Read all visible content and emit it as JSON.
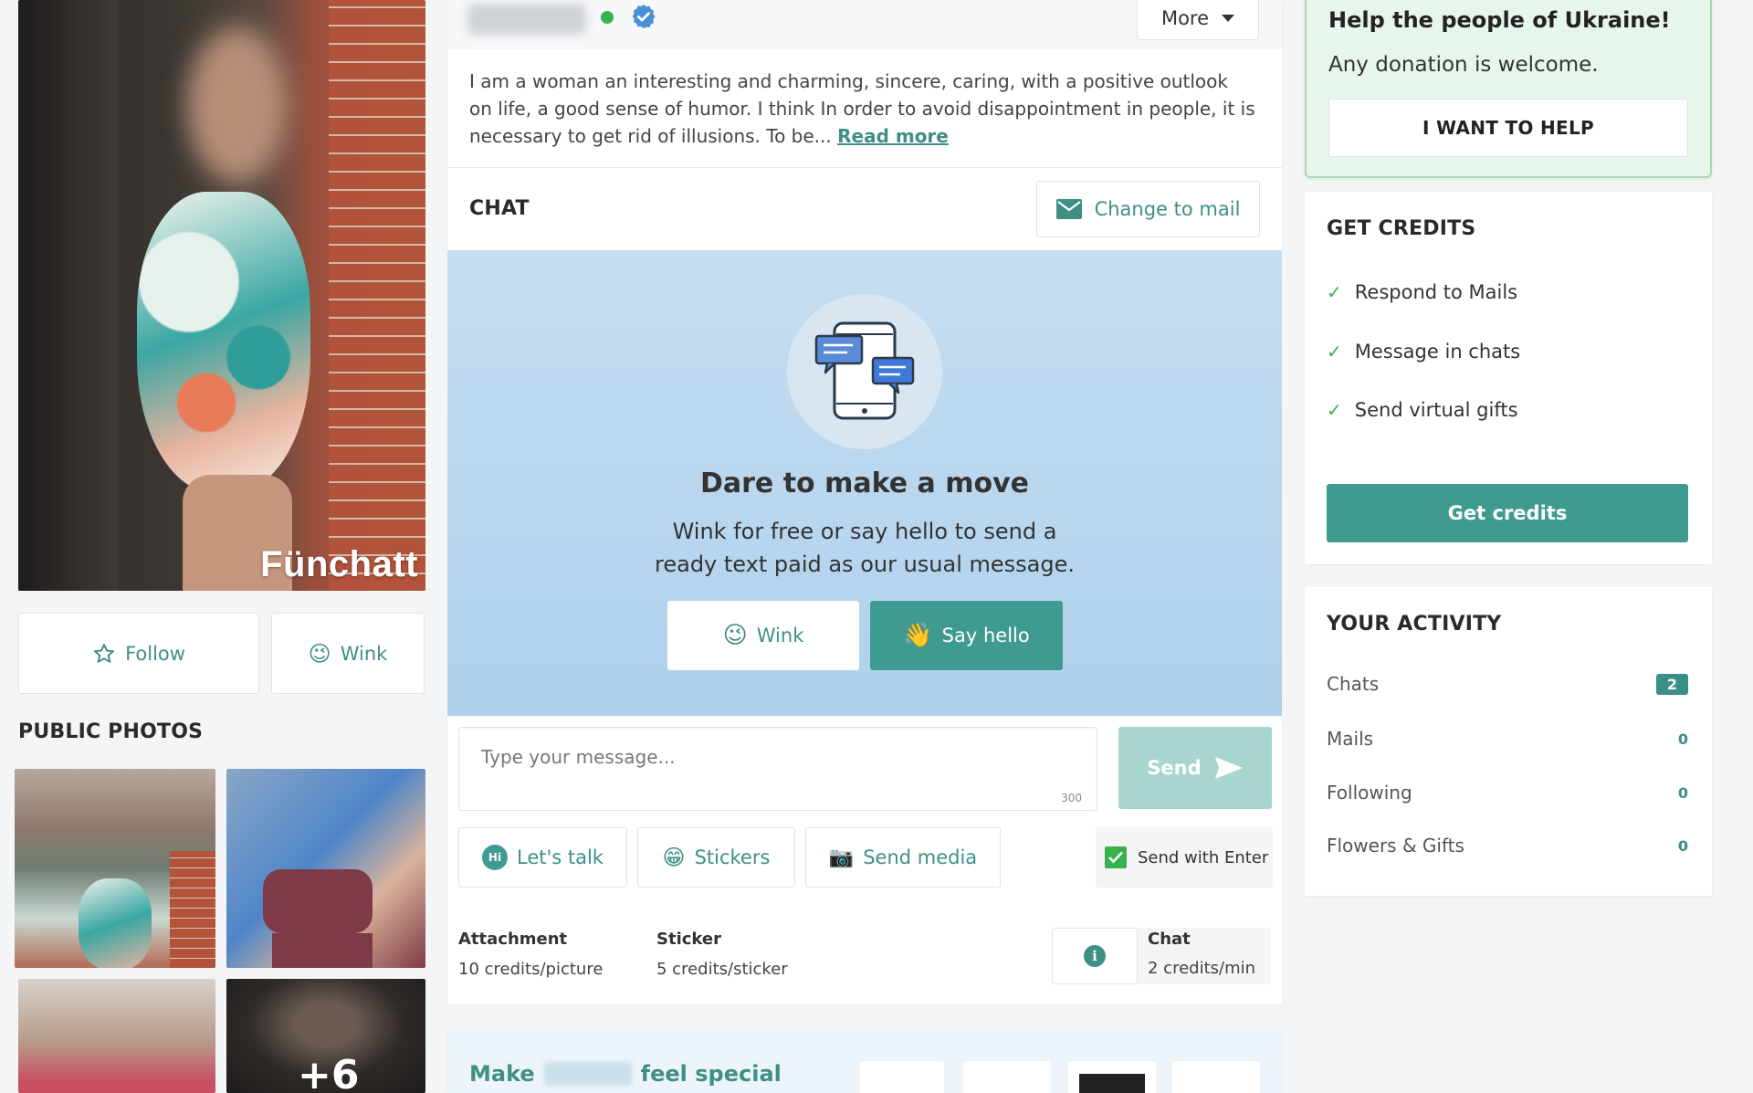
{
  "profile": {
    "watermark": "Fünchatt",
    "more_label": "More",
    "bio": "I am a woman an interesting and charming, sincere, caring, with a positive outlook on life, a good sense of humor. I think In order to avoid disappointment in people, it is necessary to get rid of illusions. To be...",
    "read_more": "Read more"
  },
  "actions": {
    "follow": "Follow",
    "wink": "Wink"
  },
  "public_photos": {
    "title": "PUBLIC PHOTOS",
    "more_count": "+6"
  },
  "chat": {
    "title": "CHAT",
    "change_to_mail": "Change to mail",
    "promo_title": "Dare to make a move",
    "promo_line1": "Wink for free or say hello to send a",
    "promo_line2": "ready text paid as our usual message.",
    "wink": "Wink",
    "say_hello": "Say hello",
    "input_placeholder": "Type your message...",
    "char_limit": "300",
    "send": "Send",
    "lets_talk": "Let's talk",
    "stickers": "Stickers",
    "send_media": "Send media",
    "send_with_enter": "Send with Enter",
    "send_with_enter_checked": true
  },
  "pricing": [
    {
      "label": "Attachment",
      "value": "10 credits/picture"
    },
    {
      "label": "Sticker",
      "value": "5 credits/sticker"
    },
    {
      "label": "Chat",
      "value": "2 credits/min"
    }
  ],
  "gifts_banner": {
    "prefix": "Make",
    "suffix": "feel special"
  },
  "ukraine": {
    "title": "Help the people of Ukraine!",
    "subtitle": "Any donation is welcome.",
    "button": "I WANT TO HELP"
  },
  "get_credits": {
    "title": "GET CREDITS",
    "items": [
      "Respond to Mails",
      "Message in chats",
      "Send virtual gifts"
    ],
    "button": "Get credits"
  },
  "activity": {
    "title": "YOUR ACTIVITY",
    "rows": [
      {
        "label": "Chats",
        "count": "2"
      },
      {
        "label": "Mails",
        "count": "0"
      },
      {
        "label": "Following",
        "count": "0"
      },
      {
        "label": "Flowers & Gifts",
        "count": "0"
      }
    ]
  },
  "colors": {
    "accent": "#3f8f86",
    "promo_bg": "#bcd8ee",
    "online": "#37b24d",
    "verified": "#4a90d9",
    "ukraine_bg": "#e6f6ea"
  }
}
